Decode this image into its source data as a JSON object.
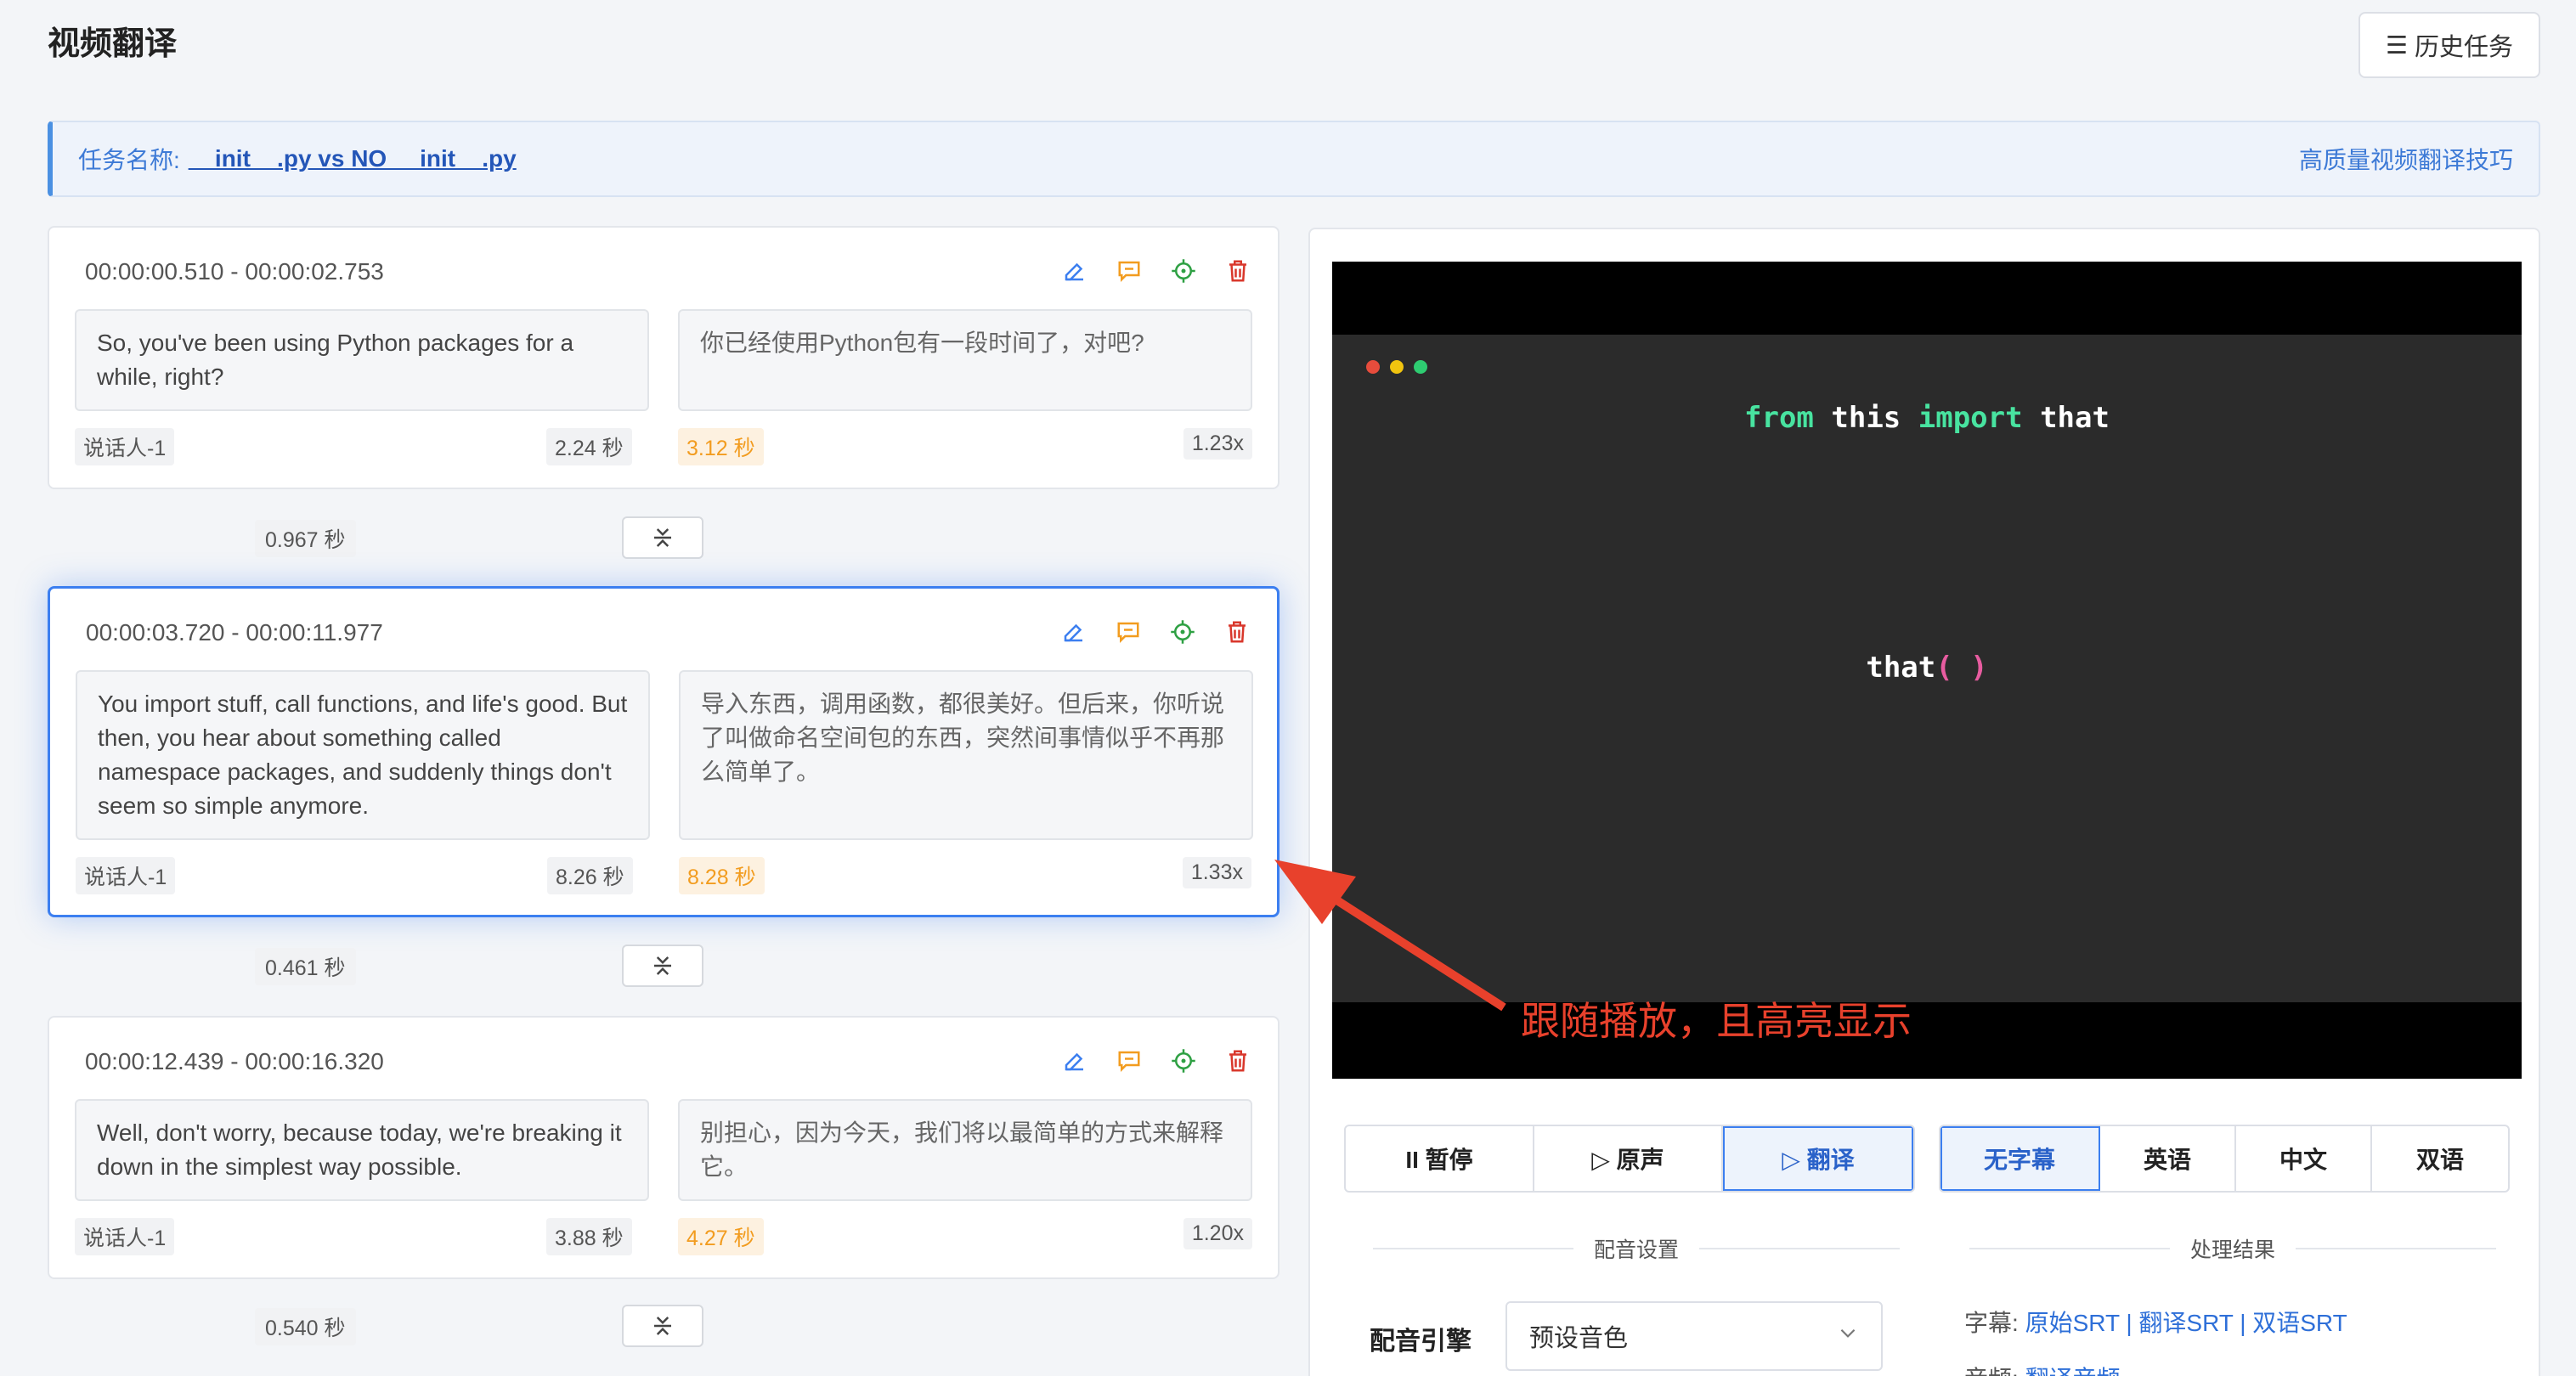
{
  "header": {
    "title": "视频翻译",
    "history_button": "历史任务",
    "history_icon": "☰"
  },
  "task": {
    "label": "任务名称:",
    "name": "__init__.py vs NO __init__.py",
    "tips_link": "高质量视频翻译技巧"
  },
  "segments": [
    {
      "time": "00:00:00.510 - 00:00:02.753",
      "source": "So, you've been using Python packages for a while, right?",
      "target": "你已经使用Python包有一段时间了，对吧?",
      "speaker": "说话人-1",
      "source_duration": "2.24 秒",
      "target_duration": "3.12 秒",
      "ratio": "1.23x"
    },
    {
      "time": "00:00:03.720 - 00:00:11.977",
      "source": "You import stuff, call functions, and life's good. But then, you hear about something called namespace packages, and suddenly things don't seem so simple anymore.",
      "target": "导入东西，调用函数，都很美好。但后来，你听说了叫做命名空间包的东西，突然间事情似乎不再那么简单了。",
      "speaker": "说话人-1",
      "source_duration": "8.26 秒",
      "target_duration": "8.28 秒",
      "ratio": "1.33x"
    },
    {
      "time": "00:00:12.439 - 00:00:16.320",
      "source": "Well, don't worry, because today, we're breaking it down in the simplest way possible.",
      "target": "别担心，因为今天，我们将以最简单的方式来解释它。",
      "speaker": "说话人-1",
      "source_duration": "3.88 秒",
      "target_duration": "4.27 秒",
      "ratio": "1.20x"
    }
  ],
  "gaps": [
    "0.967 秒",
    "0.461 秒",
    "0.540 秒"
  ],
  "video": {
    "code_line_1": {
      "kw1": "from",
      "w1": "this",
      "kw2": "import",
      "w2": "that"
    },
    "code_line_2": {
      "fn": "that",
      "paren": "( )"
    }
  },
  "annotation": "跟随播放，且高亮显示",
  "playback": {
    "pause": "II 暂停",
    "original": "▷ 原声",
    "translate": "▷ 翻译"
  },
  "subtitle_modes": [
    "无字幕",
    "英语",
    "中文",
    "双语"
  ],
  "dubbing": {
    "section_title": "配音设置",
    "engine_label": "配音引擎",
    "engine_value": "预设音色"
  },
  "results": {
    "section_title": "处理结果",
    "subtitle_label": "字幕:",
    "links": [
      "原始SRT",
      "翻译SRT",
      "双语SRT"
    ],
    "audio_label": "音频:",
    "audio_link": "翻译音频"
  },
  "colors": {
    "accent": "#3c7ff0",
    "danger_icon": "#d9372b",
    "orange": "#f29c1f",
    "green_icon": "#2ea043",
    "annotation": "#e8412c"
  }
}
